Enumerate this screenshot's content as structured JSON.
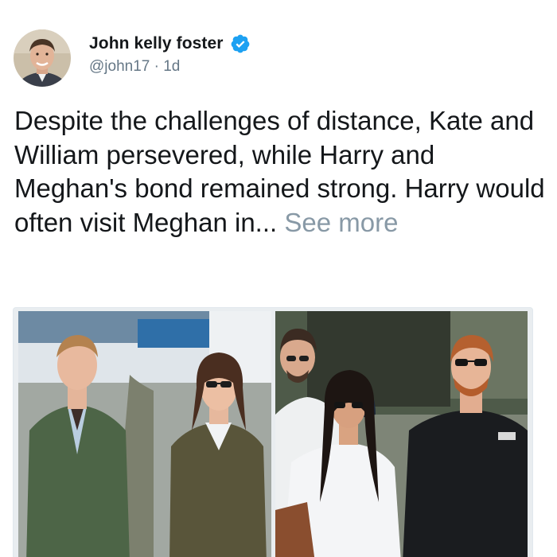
{
  "tweet": {
    "author": {
      "display_name": "John kelly foster",
      "verified": true,
      "handle": "@john17",
      "separator": " · ",
      "time": "1d",
      "avatar_icon": "user-avatar"
    },
    "text": "Despite the challenges of distance, Kate and William persevered, while Harry and Meghan's bond remained strong. Harry would often visit Meghan in...",
    "see_more": "See more",
    "media": {
      "photo_count": 2
    },
    "colors": {
      "name": "#14171a",
      "secondary": "#657786",
      "see_more": "#8899a6",
      "verified": "#1da1f2"
    }
  }
}
